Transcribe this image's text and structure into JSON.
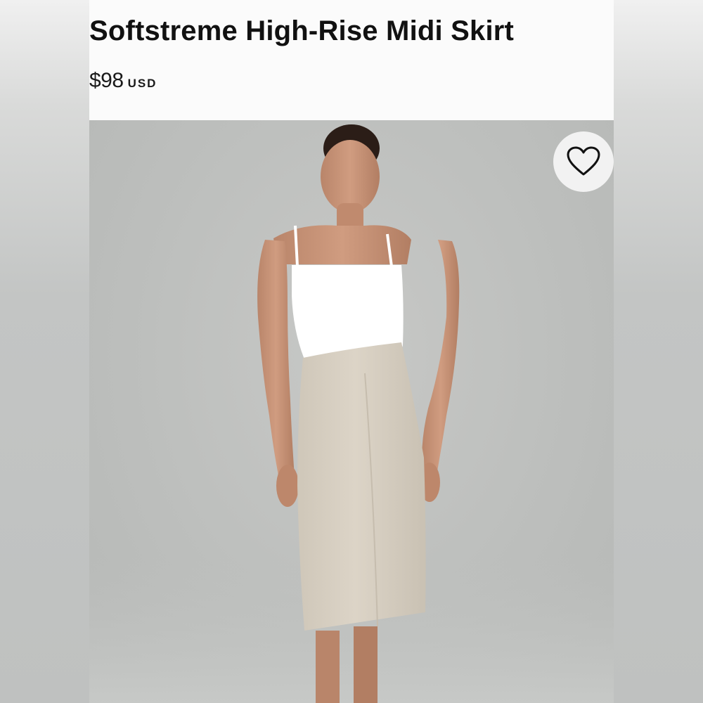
{
  "product": {
    "title": "Softstreme High-Rise Midi Skirt",
    "price": "$98",
    "currency": "USD"
  },
  "image": {
    "alt": "Model wearing Softstreme High-Rise Midi Skirt"
  },
  "actions": {
    "favorite_icon": "heart-icon",
    "favorite_label": "Add to wishlist"
  },
  "colors": {
    "skirt": "#d8d0c3",
    "top": "#ffffff",
    "background": "#c2c4c3"
  }
}
